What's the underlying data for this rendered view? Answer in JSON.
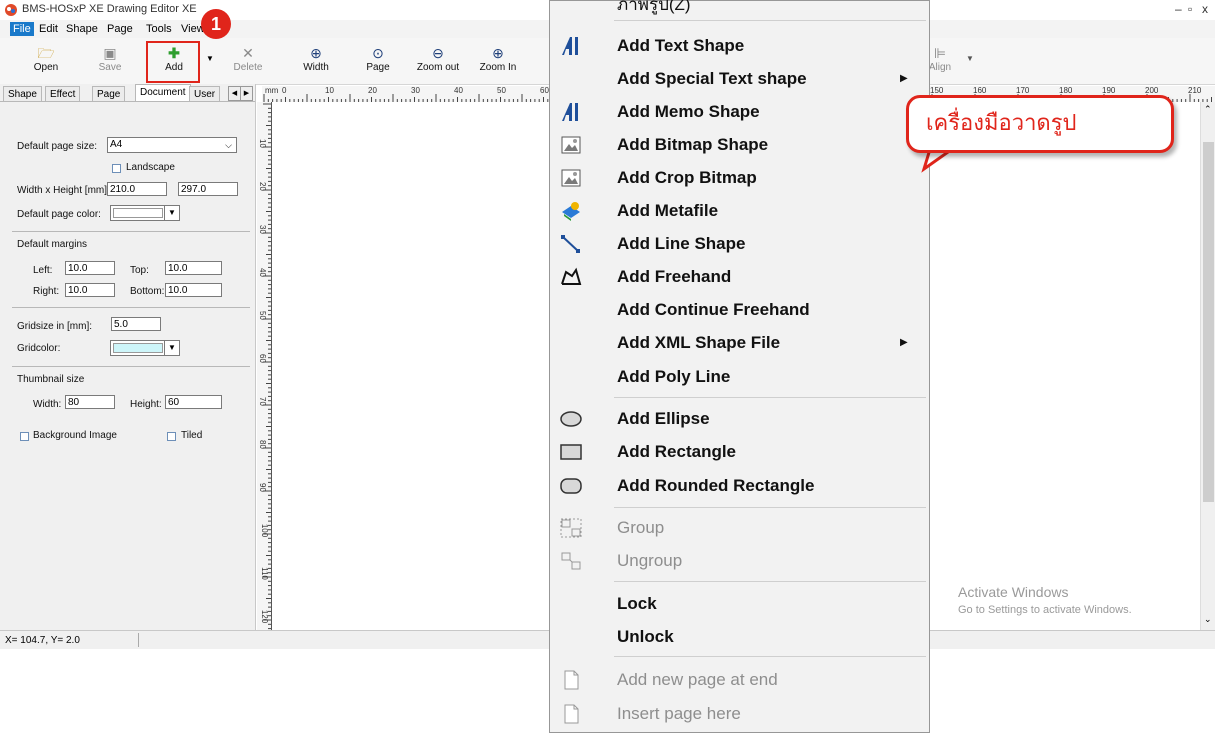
{
  "app": {
    "title": "BMS-HOSxP XE Drawing Editor XE"
  },
  "menubar": [
    "File",
    "Edit",
    "Shape",
    "Page",
    "Tools",
    "View"
  ],
  "toolbar": {
    "buttons": [
      {
        "label": "Open",
        "icon": "folder-open-icon"
      },
      {
        "label": "Save",
        "icon": "save-icon"
      },
      {
        "label": "Add",
        "icon": "plus-icon"
      },
      {
        "label": "Delete",
        "icon": "delete-icon"
      },
      {
        "label": "Width",
        "icon": "zoom-width-icon"
      },
      {
        "label": "Page",
        "icon": "zoom-page-icon"
      },
      {
        "label": "Zoom out",
        "icon": "zoom-out-icon"
      },
      {
        "label": "Zoom In",
        "icon": "zoom-in-icon"
      },
      {
        "label": "Align",
        "icon": "align-icon"
      }
    ],
    "badge": "1",
    "accent": "#e0251b"
  },
  "left_panel": {
    "tabs": [
      "Shape",
      "Effect",
      "Page",
      "Document",
      "User"
    ],
    "active_tab": "Document",
    "page_size_label": "Default page size:",
    "page_size_value": "A4",
    "landscape_label": "Landscape",
    "wh_label": "Width x Height [mm]",
    "width_value": "210.0",
    "height_value": "297.0",
    "page_color_label": "Default page color:",
    "margins_label": "Default margins",
    "left_label": "Left:",
    "left_value": "10.0",
    "top_label": "Top:",
    "top_value": "10.0",
    "right_label": "Right:",
    "right_value": "10.0",
    "bottom_label": "Bottom:",
    "bottom_value": "10.0",
    "gridsize_label": "Gridsize in [mm]:",
    "gridsize_value": "5.0",
    "gridcolor_label": "Gridcolor:",
    "gridcolor": "#cdf5f9",
    "thumb_label": "Thumbnail size",
    "thumb_w_label": "Width:",
    "thumb_w_value": "80",
    "thumb_h_label": "Height:",
    "thumb_h_value": "60",
    "bg_image_label": "Background Image",
    "tiled_label": "Tiled"
  },
  "rulers": {
    "unit": "mm",
    "h_ticks": [
      "0",
      "10",
      "20",
      "30",
      "40",
      "50",
      "60"
    ],
    "h_ticks_right": [
      "150",
      "160",
      "170",
      "180",
      "190",
      "200",
      "210"
    ],
    "v_ticks": [
      "10",
      "20",
      "30",
      "40",
      "50",
      "60",
      "70",
      "80",
      "90",
      "100",
      "110",
      "120"
    ]
  },
  "status": {
    "coords": "X= 104.7, Y=  2.0"
  },
  "watermark": {
    "line1": "Activate Windows",
    "line2": "Go to Settings to activate Windows."
  },
  "context_menu": {
    "top_partial": "ภาพรูป(Z)",
    "items": [
      {
        "label": "Add Text Shape",
        "icon": "text-shape-icon"
      },
      {
        "label": "Add Special Text shape",
        "submenu": true
      },
      {
        "label": "Add Memo Shape",
        "icon": "memo-shape-icon"
      },
      {
        "label": "Add Bitmap Shape",
        "icon": "bitmap-icon"
      },
      {
        "label": "Add Crop Bitmap",
        "icon": "crop-bitmap-icon"
      },
      {
        "label": "Add Metafile",
        "icon": "metafile-icon"
      },
      {
        "label": "Add Line Shape",
        "icon": "line-shape-icon"
      },
      {
        "label": "Add Freehand",
        "icon": "freehand-icon"
      },
      {
        "label": "Add Continue Freehand"
      },
      {
        "label": "Add XML Shape File",
        "submenu": true
      },
      {
        "label": "Add Poly Line"
      },
      {
        "label": "Add Ellipse",
        "icon": "ellipse-icon"
      },
      {
        "label": "Add Rectangle",
        "icon": "rectangle-icon"
      },
      {
        "label": "Add Rounded Rectangle",
        "icon": "rounded-rectangle-icon"
      },
      {
        "label": "Group",
        "icon": "group-icon",
        "disabled": true
      },
      {
        "label": "Ungroup",
        "icon": "ungroup-icon",
        "disabled": true
      },
      {
        "label": "Lock"
      },
      {
        "label": "Unlock"
      },
      {
        "label": "Add new page at end",
        "icon": "page-icon",
        "disabled": true
      },
      {
        "label": "Insert page here",
        "icon": "page-icon",
        "disabled": true
      }
    ]
  },
  "callout": {
    "text": "เครื่องมือวาดรูป",
    "color": "#e0251b"
  }
}
